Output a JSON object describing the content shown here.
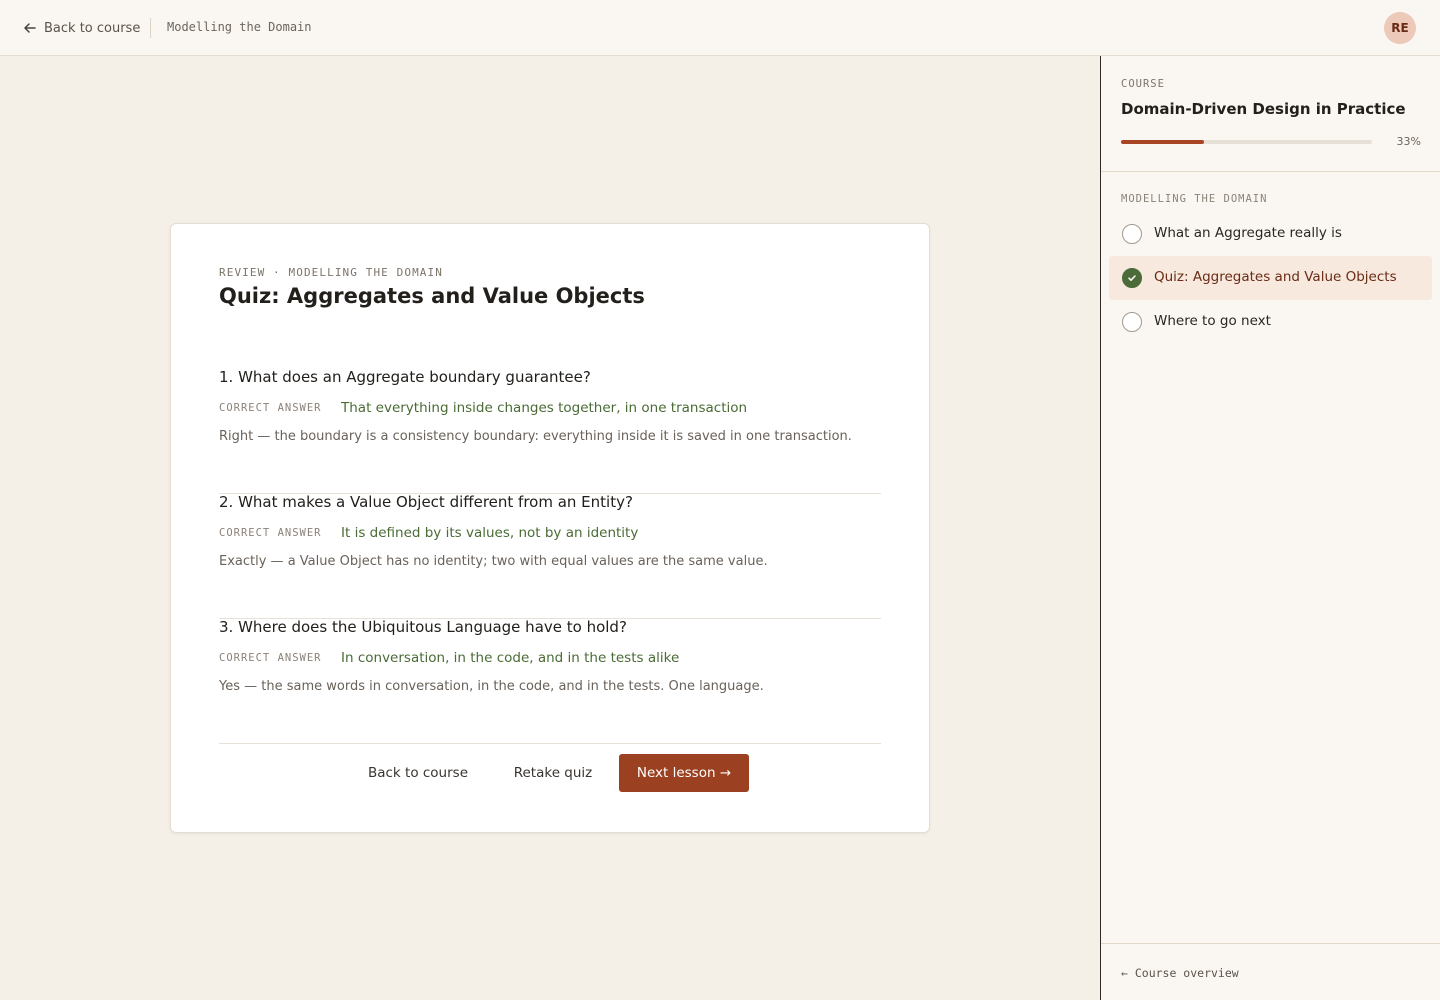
{
  "topbar": {
    "back_label": "Back to course",
    "crumb": "Modelling the Domain",
    "avatar_initials": "RE"
  },
  "quiz": {
    "eyebrow": "REVIEW · MODELLING THE DOMAIN",
    "title": "Quiz: Aggregates and Value Objects",
    "answer_label": "CORRECT ANSWER",
    "questions": [
      {
        "text": "1. What does an Aggregate boundary guarantee?",
        "answer": "That everything inside changes together, in one transaction",
        "explanation": "Right — the boundary is a consistency boundary: everything inside it is saved in one transaction."
      },
      {
        "text": "2. What makes a Value Object different from an Entity?",
        "answer": "It is defined by its values, not by an identity",
        "explanation": "Exactly — a Value Object has no identity; two with equal values are the same value."
      },
      {
        "text": "3. Where does the Ubiquitous Language have to hold?",
        "answer": "In conversation, in the code, and in the tests alike",
        "explanation": "Yes — the same words in conversation, in the code, and in the tests. One language."
      }
    ],
    "actions": {
      "back": "Back to course",
      "retake": "Retake quiz",
      "next": "Next lesson →"
    }
  },
  "sidebar": {
    "kicker": "COURSE",
    "course_title": "Domain-Driven Design in Practice",
    "progress": 0.33,
    "progress_label": "33%",
    "module_label": "MODELLING THE DOMAIN",
    "lessons": [
      {
        "label": "What an Aggregate really is",
        "completed": false,
        "active": false
      },
      {
        "label": "Quiz: Aggregates and Value Objects",
        "completed": true,
        "active": true
      },
      {
        "label": "Where to go next",
        "completed": false,
        "active": false
      }
    ],
    "footer_link": "← Course overview"
  },
  "colors": {
    "accent": "#9b4020",
    "success": "#4b6b38",
    "background": "#f4f0e8"
  }
}
